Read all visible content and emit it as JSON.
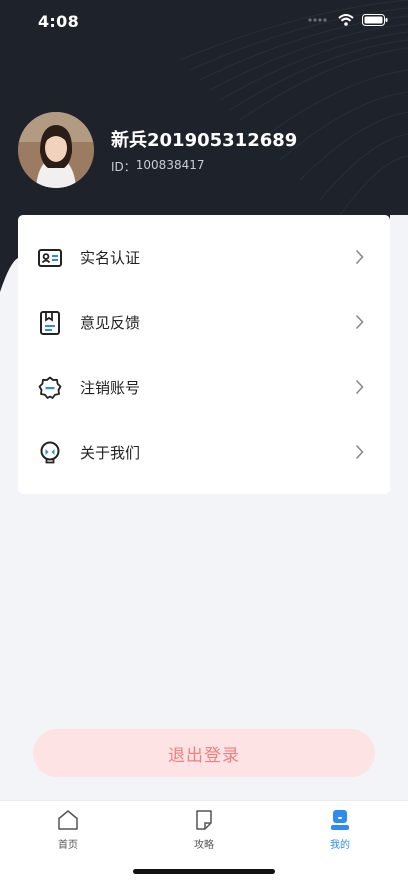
{
  "status_bar": {
    "time": "4:08"
  },
  "profile": {
    "username": "新兵201905312689",
    "id_label": "ID：",
    "id_value": "100838417"
  },
  "menu": {
    "items": [
      {
        "label": "实名认证",
        "icon": "id-card-icon"
      },
      {
        "label": "意见反馈",
        "icon": "feedback-book-icon"
      },
      {
        "label": "注销账号",
        "icon": "badge-minus-icon"
      },
      {
        "label": "关于我们",
        "icon": "lightbulb-icon"
      }
    ]
  },
  "logout": {
    "label": "退出登录"
  },
  "tabbar": {
    "tabs": [
      {
        "label": "首页",
        "icon": "home-icon",
        "active": false
      },
      {
        "label": "攻略",
        "icon": "guide-note-icon",
        "active": false
      },
      {
        "label": "我的",
        "icon": "profile-icon",
        "active": true
      }
    ]
  },
  "colors": {
    "header_bg": "#1d222b",
    "accent": "#2f8bf0",
    "logout_bg": "#fde3e3",
    "logout_text": "#f08080"
  }
}
